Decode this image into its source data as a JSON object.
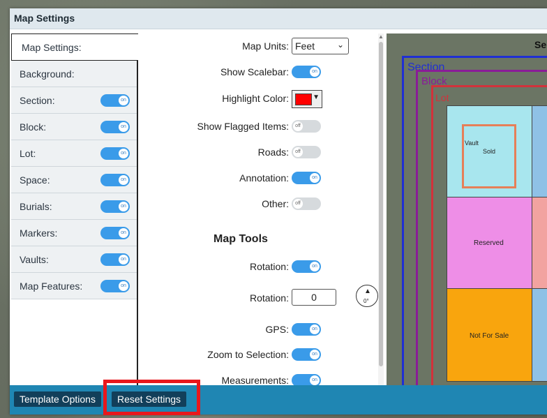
{
  "window": {
    "title": "Map Settings"
  },
  "tabs": [
    {
      "label": "Map Settings:",
      "active": true
    },
    {
      "label": "Background:"
    },
    {
      "label": "Section:",
      "toggle": "on"
    },
    {
      "label": "Block:",
      "toggle": "on"
    },
    {
      "label": "Lot:",
      "toggle": "on"
    },
    {
      "label": "Space:",
      "toggle": "on"
    },
    {
      "label": "Burials:",
      "toggle": "on"
    },
    {
      "label": "Markers:",
      "toggle": "on"
    },
    {
      "label": "Vaults:",
      "toggle": "on"
    },
    {
      "label": "Map Features:",
      "toggle": "on"
    }
  ],
  "settings": {
    "map_units_label": "Map Units:",
    "map_units_value": "Feet",
    "show_scalebar_label": "Show Scalebar:",
    "show_scalebar": "on",
    "highlight_color_label": "Highlight Color:",
    "highlight_color": "#ff0000",
    "show_flagged_label": "Show Flagged Items:",
    "show_flagged": "off",
    "roads_label": "Roads:",
    "roads": "off",
    "annotation_label": "Annotation:",
    "annotation": "on",
    "other_label": "Other:",
    "other": "off"
  },
  "map_tools": {
    "heading": "Map Tools",
    "rotation_toggle_label": "Rotation:",
    "rotation_toggle": "on",
    "rotation_value_label": "Rotation:",
    "rotation_value": "0",
    "compass_deg": "0°",
    "gps_label": "GPS:",
    "gps": "on",
    "zoom_label": "Zoom to Selection:",
    "zoom": "on",
    "measurements_label": "Measurements:",
    "measurements": "on"
  },
  "preview": {
    "header": "Se",
    "section_label": "Section",
    "block_label": "Block",
    "lot_label": "Lot",
    "vault_label": "Vault",
    "sold_label": "Sold",
    "reserved_label": "Reserved",
    "not_for_sale_label": "Not For Sale"
  },
  "footer": {
    "template_options": "Template Options",
    "reset_settings": "Reset Settings"
  },
  "colors": {
    "accent": "#3a9be9",
    "footer": "#1f86b3",
    "highlight_box": "#e8171c"
  }
}
